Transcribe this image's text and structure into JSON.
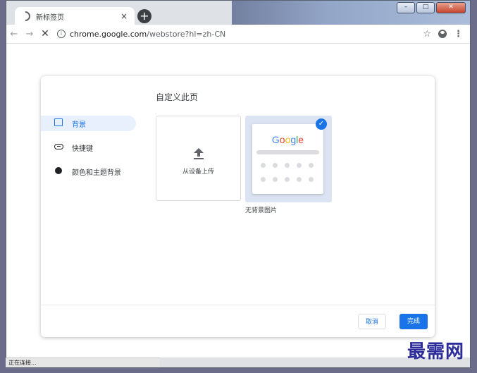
{
  "tab": {
    "title": "新标签页",
    "close": "×",
    "new_tab": "+"
  },
  "window_controls": {
    "minimize": "–",
    "maximize": "□",
    "close": "✕"
  },
  "toolbar": {
    "back": "←",
    "forward": "→",
    "stop": "✕",
    "info": "i",
    "url_host": "chrome.google.com",
    "url_path": "/webstore?hl=zh-CN",
    "star": "☆",
    "menu": "⋮"
  },
  "dialog": {
    "title": "自定义此页",
    "menu": [
      {
        "label": "背景",
        "icon": "image-icon",
        "active": true
      },
      {
        "label": "快捷键",
        "icon": "link-icon",
        "active": false
      },
      {
        "label": "颜色和主题背景",
        "icon": "palette-icon",
        "active": false
      }
    ],
    "upload_label": "从设备上传",
    "no_background_label": "无背景图片",
    "cancel": "取消",
    "done": "完成"
  },
  "preview": {
    "logo": [
      {
        "ch": "G",
        "color": "#4285f4"
      },
      {
        "ch": "o",
        "color": "#ea4335"
      },
      {
        "ch": "o",
        "color": "#fbbc05"
      },
      {
        "ch": "g",
        "color": "#4285f4"
      },
      {
        "ch": "l",
        "color": "#34a853"
      },
      {
        "ch": "e",
        "color": "#ea4335"
      }
    ],
    "check": "✓"
  },
  "status_bar": "正在连接...",
  "watermark": "最需网",
  "colors": {
    "accent": "#1a73e8",
    "selected_tile": "#dce3f3"
  }
}
